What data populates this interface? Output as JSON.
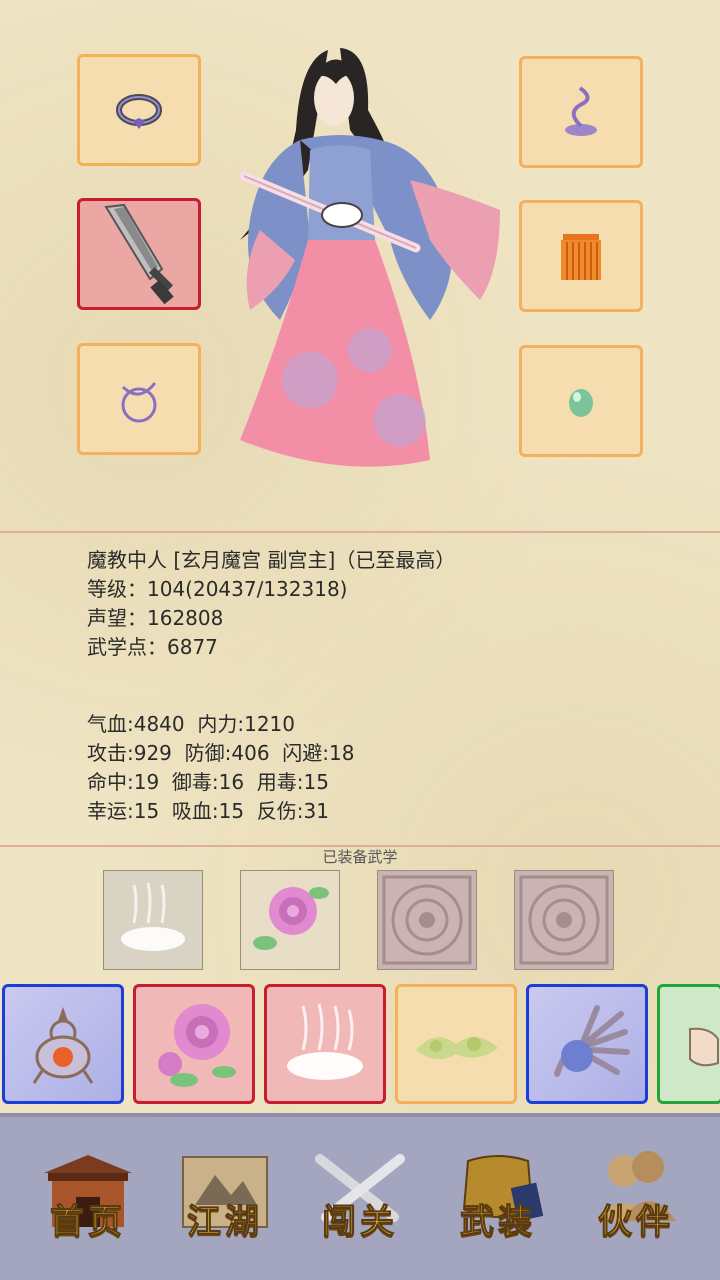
{
  "character": {
    "title_line": "魔教中人 [玄月魔宫 副宫主]（已至最高）",
    "level_line": "等级：104(20437/132318)",
    "prestige_line": "声望：162808",
    "martial_points_line": "武学点：6877"
  },
  "stats": {
    "row1": "气血:4840  内力:1210",
    "row2": "攻击:929  防御:406  闪避:18",
    "row3": "命中:19  御毒:16  用毒:15",
    "row4": "幸运:15  吸血:15  反伤:31"
  },
  "equipment_slots": [
    {
      "position": "top-left",
      "icon": "ring-icon",
      "rarity_color": "#f3b15c"
    },
    {
      "position": "mid-left",
      "icon": "broadsword-icon",
      "rarity_color": "#c81d2e"
    },
    {
      "position": "bottom-left",
      "icon": "bracelet-icon",
      "rarity_color": "#f3b15c"
    },
    {
      "position": "top-right",
      "icon": "hairpin-icon",
      "rarity_color": "#f3b15c"
    },
    {
      "position": "mid-right",
      "icon": "robe-icon",
      "rarity_color": "#f3b15c"
    },
    {
      "position": "bottom-right",
      "icon": "jade-icon",
      "rarity_color": "#f3b15c"
    }
  ],
  "equipped_martial_arts": {
    "label": "已装备武学",
    "items": [
      "mist-art-icon",
      "rose-art-icon",
      "locked-seal-icon",
      "locked-seal-icon"
    ]
  },
  "skill_bar": [
    {
      "icon": "furnace-icon",
      "rarity_color": "#1b3fd6"
    },
    {
      "icon": "rose-art-icon",
      "rarity_color": "#c81d2e"
    },
    {
      "icon": "mist-art-icon",
      "rarity_color": "#c81d2e"
    },
    {
      "icon": "herb-icon",
      "rarity_color": "#f3b15c"
    },
    {
      "icon": "palm-icon",
      "rarity_color": "#1b3fd6"
    },
    {
      "icon": "fist-icon",
      "rarity_color": "#24a53a"
    }
  ],
  "nav": {
    "home": "首页",
    "jianghu": "江湖",
    "challenge": "闯关",
    "equipment": "武装",
    "partner": "伙伴"
  }
}
